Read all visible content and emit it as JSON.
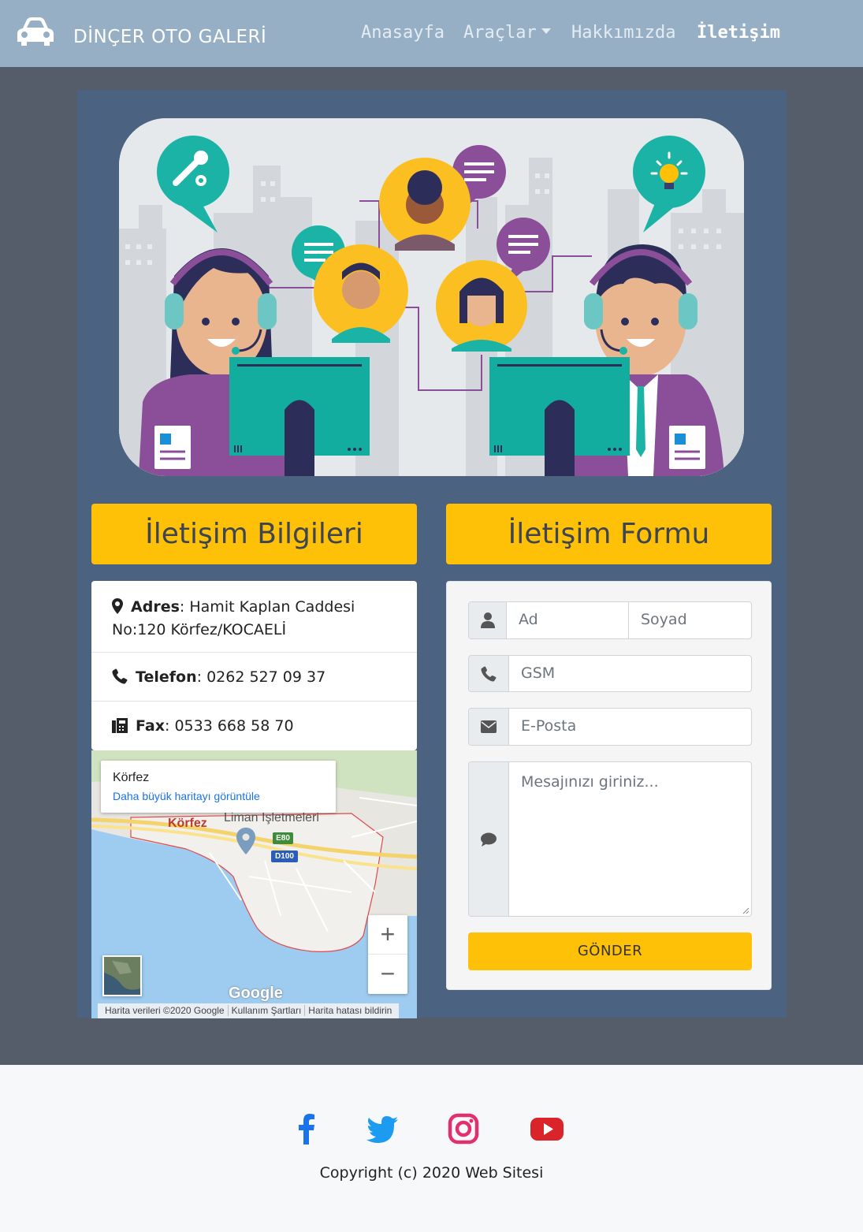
{
  "navbar": {
    "brand": "DİNÇER OTO GALERİ",
    "brand_icon": "car-icon",
    "links": [
      "Anasayfa",
      "Araçlar",
      "Hakkımızda",
      "İletişim"
    ],
    "active_link": "İletişim"
  },
  "hero": {
    "image": "customer-support-illustration"
  },
  "contact_info": {
    "heading": "İletişim Bilgileri",
    "address_label": "Adres",
    "address_line1": "Hamit Kaplan Caddesi",
    "address_line2": "No:120 Körfez/KOCAELİ",
    "phone_label": "Telefon",
    "phone": "0262 527 09 37",
    "fax_label": "Fax",
    "fax": "0533 668 58 70"
  },
  "map": {
    "place": "Körfez",
    "view_larger": "Daha büyük haritayı görüntüle",
    "label_town": "Körfez",
    "label_port": "Liman İşletmeleri",
    "road_e80": "E80",
    "road_d100": "D100",
    "zoom_in": "+",
    "zoom_out": "−",
    "google": "Google",
    "attribution": [
      "Harita verileri ©2020 Google",
      "Kullanım Şartları",
      "Harita hatası bildirin"
    ]
  },
  "contact_form": {
    "heading": "İletişim Formu",
    "first_name_placeholder": "Ad",
    "last_name_placeholder": "Soyad",
    "gsm_placeholder": "GSM",
    "email_placeholder": "E-Posta",
    "message_placeholder": "Mesajınızı giriniz...",
    "submit": "GÖNDER"
  },
  "footer": {
    "social": [
      "facebook-icon",
      "twitter-icon",
      "instagram-icon",
      "youtube-icon"
    ],
    "copyright": "Copyright (c) 2020 Web Sitesi"
  },
  "colors": {
    "navbar": "#96afc4",
    "page_bg": "#555d6b",
    "panel": "#4b6380",
    "accent": "#fec107"
  }
}
